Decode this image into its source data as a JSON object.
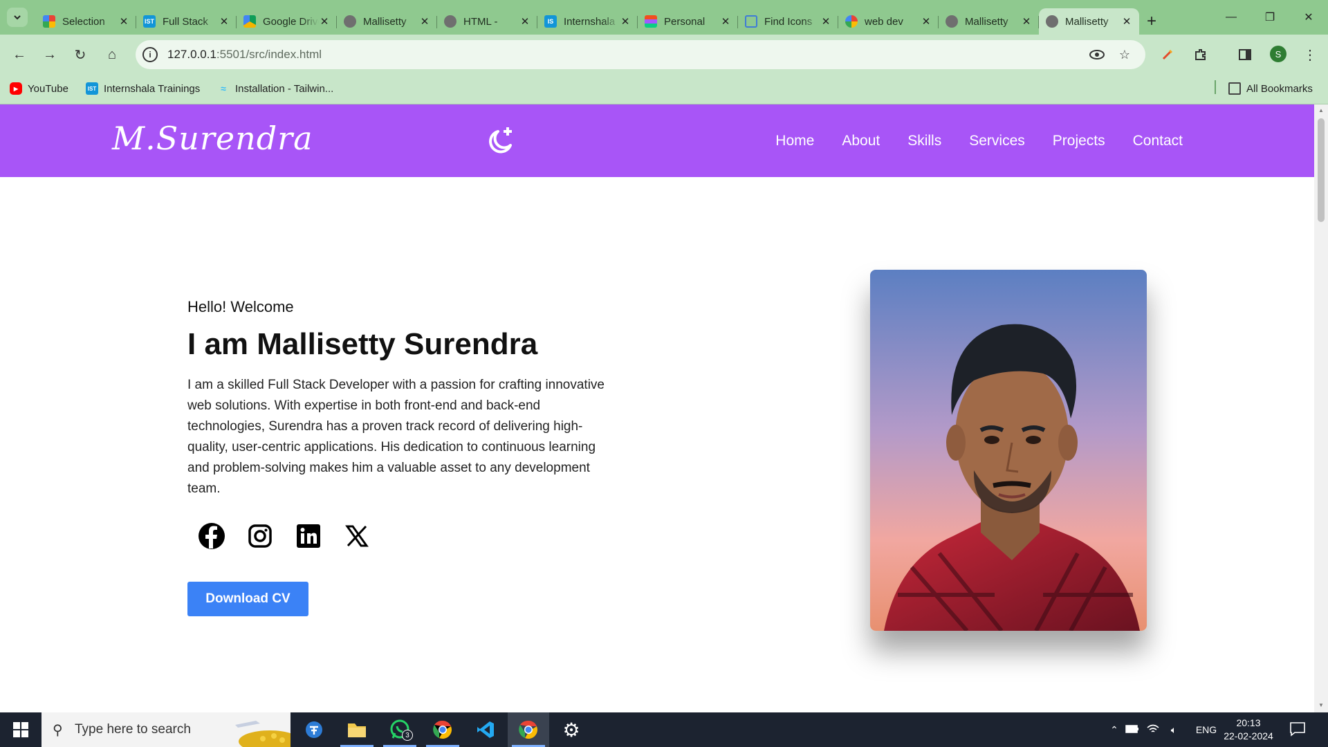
{
  "browser": {
    "tabs": [
      {
        "title": "Selection",
        "favicon": "google-workspace-icon",
        "color": "#4285f4",
        "active": false
      },
      {
        "title": "Full Stack",
        "favicon": "internshala-icon",
        "color": "#1295d8",
        "active": false
      },
      {
        "title": "Google Drive",
        "favicon": "google-drive-icon",
        "color": "#f4b400",
        "active": false
      },
      {
        "title": "Mallisetty",
        "favicon": "globe-icon",
        "color": "#7a7a7a",
        "active": false
      },
      {
        "title": "HTML - ",
        "favicon": "globe-icon",
        "color": "#7a7a7a",
        "active": false
      },
      {
        "title": "Internshala",
        "favicon": "internshala-icon",
        "color": "#1295d8",
        "active": false
      },
      {
        "title": "Personal",
        "favicon": "figma-icon",
        "color": "#a259ff",
        "active": false
      },
      {
        "title": "Find Icons",
        "favicon": "flag-icon",
        "color": "#3f7bd6",
        "active": false
      },
      {
        "title": "web dev",
        "favicon": "google-icon",
        "color": "#4285f4",
        "active": false
      },
      {
        "title": "Mallisetty",
        "favicon": "globe-icon",
        "color": "#7a7a7a",
        "active": false
      },
      {
        "title": "Mallisetty",
        "favicon": "globe-icon",
        "color": "#7a7a7a",
        "active": true
      }
    ],
    "tab_favicon_text": {
      "internshala": "IST",
      "internshala2": "IS"
    },
    "url_host": "127.0.0.1",
    "url_path": ":5501/src/index.html",
    "profile_initial": "S",
    "bookmarks": {
      "youtube": "YouTube",
      "internshala": "Internshala Trainings",
      "tailwind": "Installation - Tailwin...",
      "all": "All Bookmarks"
    }
  },
  "site": {
    "logo": "M.Surendra",
    "nav": [
      "Home",
      "About",
      "Skills",
      "Services",
      "Projects",
      "Contact"
    ],
    "hero": {
      "greeting": "Hello! Welcome",
      "title": "I am Mallisetty Surendra",
      "description": "I am a skilled Full Stack Developer with a passion for crafting innovative web solutions. With expertise in both front-end and back-end technologies, Surendra has a proven track record of delivering high-quality, user-centric applications. His dedication to continuous learning and problem-solving makes him a valuable asset to any development team.",
      "cv_button": "Download CV",
      "socials": [
        "facebook-icon",
        "instagram-icon",
        "linkedin-icon",
        "x-icon"
      ]
    },
    "colors": {
      "header": "#a855f7",
      "button": "#3b82f6"
    }
  },
  "taskbar": {
    "search_placeholder": "Type here to search",
    "whatsapp_badge": "3",
    "language": "ENG",
    "time": "20:13",
    "date": "22-02-2024"
  }
}
